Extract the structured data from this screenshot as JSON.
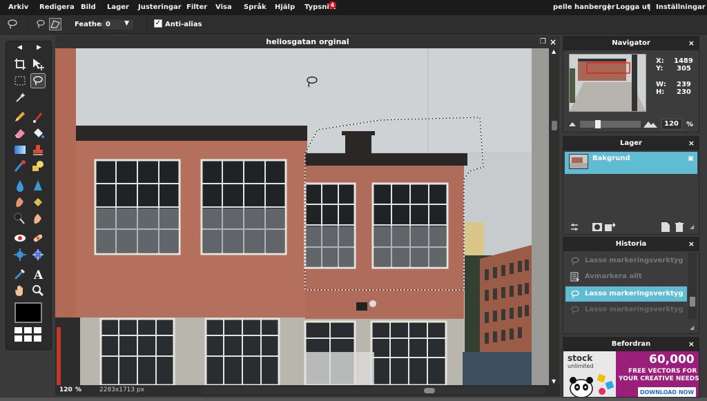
{
  "menubar": {
    "items": [
      "Arkiv",
      "Redigera",
      "Bild",
      "Lager",
      "Justeringar",
      "Filter",
      "Visa",
      "Språk",
      "Hjälp",
      "Typsnitt"
    ],
    "badge_count": "4",
    "user": "pelle hanberger",
    "logout": "Logga ut",
    "settings": "Inställningar",
    "separator": "|"
  },
  "options": {
    "feather_label": "Feather:",
    "feather_value": "0",
    "antialias_label": "Anti-alias",
    "antialias_checked": "✓"
  },
  "document": {
    "title": "heliosgatan orginal",
    "zoom": "120",
    "zoom_unit": "%",
    "dimensions": "2283x1713 px"
  },
  "navigator": {
    "title": "Navigator",
    "x_label": "X:",
    "x_value": "1489",
    "y_label": "Y:",
    "y_value": "305",
    "w_label": "W:",
    "w_value": "239",
    "h_label": "H:",
    "h_value": "230",
    "zoom_value": "120",
    "zoom_unit": "%",
    "zoom_level": 0.2
  },
  "layers": {
    "title": "Lager",
    "items": [
      {
        "name": "Bakgrund"
      }
    ]
  },
  "history": {
    "title": "Historia",
    "items": [
      {
        "label": "Lasso markeringsverktyg"
      },
      {
        "label": "Avmarkera allt"
      },
      {
        "label": "Lasso markeringsverktyg"
      },
      {
        "label": "Lasso markeringsverktyg"
      }
    ]
  },
  "ad": {
    "title": "Befordran",
    "brand_top": "stock",
    "brand_bottom": "unlimited",
    "headline": "60,000",
    "line1": "FREE VECTORS FOR",
    "line2": "YOUR CREATIVE NEEDS",
    "cta": "DOWNLOAD NOW"
  },
  "colors": {
    "accent": "#5fbcd3",
    "menubar": "#1b1b1b",
    "panel": "#3c3c3c",
    "wall": "#b9735f",
    "ad_bg": "#9b1f7a"
  },
  "icons": {
    "close": "×",
    "lock": "🔒"
  }
}
